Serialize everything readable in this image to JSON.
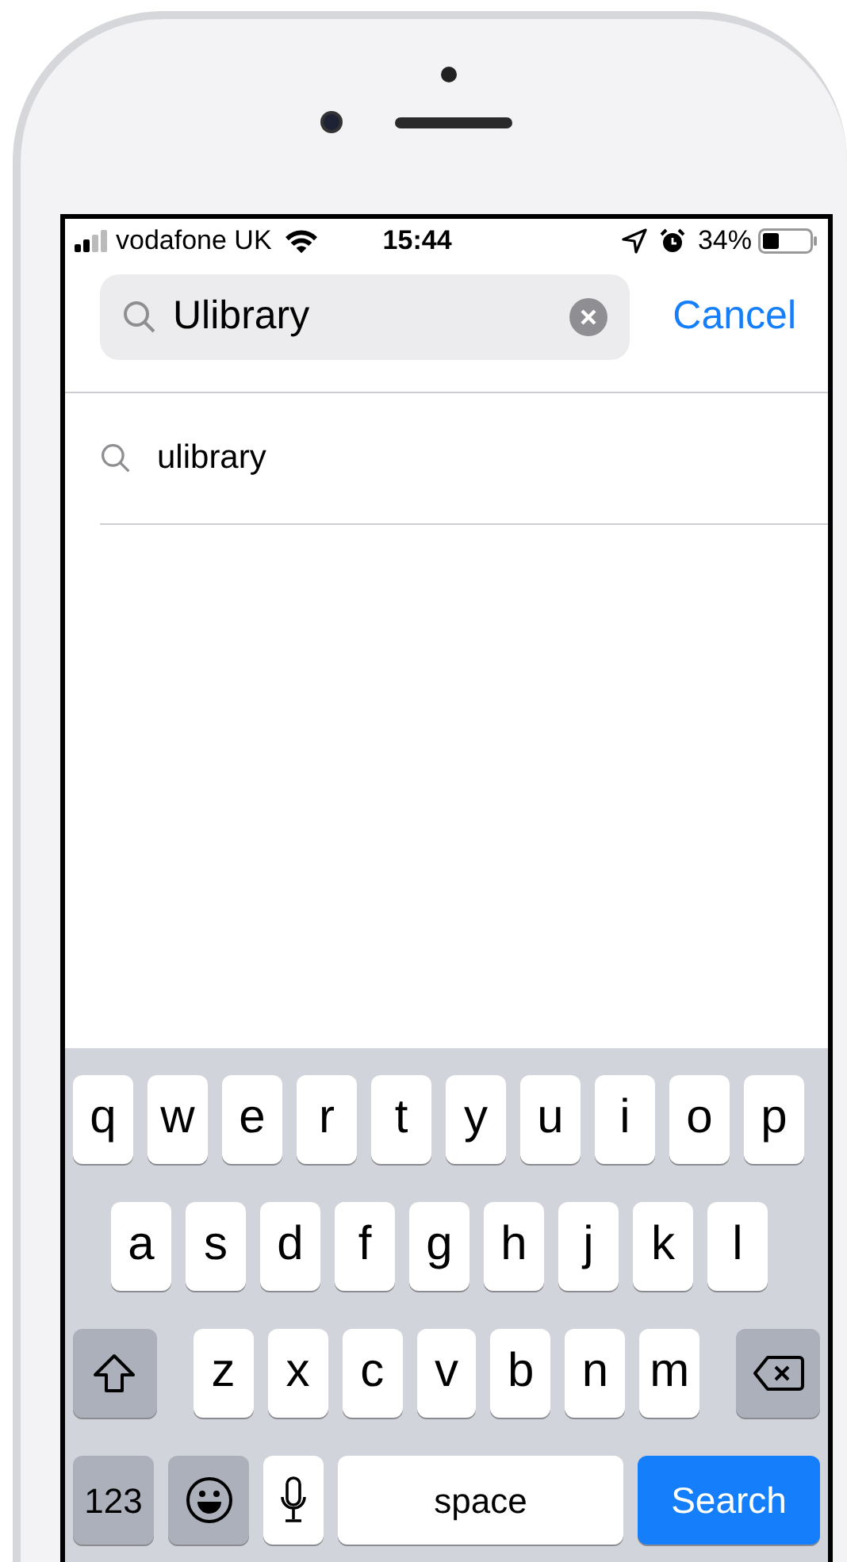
{
  "status_bar": {
    "carrier": "vodafone UK",
    "time": "15:44",
    "battery": "34%"
  },
  "search": {
    "value": "Ulibrary",
    "cancel": "Cancel"
  },
  "suggestions": [
    {
      "text": "ulibrary"
    }
  ],
  "keyboard": {
    "top_letters": [
      {
        "kind": "letter",
        "label": "q"
      },
      {
        "kind": "letter",
        "label": "w"
      },
      {
        "kind": "letter",
        "label": "e"
      },
      {
        "kind": "letter",
        "label": "r"
      },
      {
        "kind": "letter",
        "label": "t"
      },
      {
        "kind": "letter",
        "label": "y"
      },
      {
        "kind": "letter",
        "label": "u"
      },
      {
        "kind": "letter",
        "label": "i"
      },
      {
        "kind": "letter",
        "label": "o"
      },
      {
        "kind": "letter",
        "label": "p"
      }
    ],
    "middle_letters": [
      {
        "kind": "letter",
        "label": "a"
      },
      {
        "kind": "letter",
        "label": "s"
      },
      {
        "kind": "letter",
        "label": "d"
      },
      {
        "kind": "letter",
        "label": "f"
      },
      {
        "kind": "letter",
        "label": "g"
      },
      {
        "kind": "letter",
        "label": "h"
      },
      {
        "kind": "letter",
        "label": "j"
      },
      {
        "kind": "letter",
        "label": "k"
      },
      {
        "kind": "letter",
        "label": "l"
      }
    ],
    "bottom_letters": [
      {
        "kind": "shift"
      },
      {
        "kind": "letter",
        "label": "z"
      },
      {
        "kind": "letter",
        "label": "x"
      },
      {
        "kind": "letter",
        "label": "c"
      },
      {
        "kind": "letter",
        "label": "v"
      },
      {
        "kind": "letter",
        "label": "b"
      },
      {
        "kind": "letter",
        "label": "n"
      },
      {
        "kind": "letter",
        "label": "m"
      },
      {
        "kind": "delete"
      }
    ],
    "function_keys": [
      {
        "kind": "numbers",
        "label": "123"
      },
      {
        "kind": "emoji"
      },
      {
        "kind": "mic"
      },
      {
        "kind": "space",
        "label": "space"
      },
      {
        "kind": "action",
        "label": "Search"
      }
    ]
  }
}
